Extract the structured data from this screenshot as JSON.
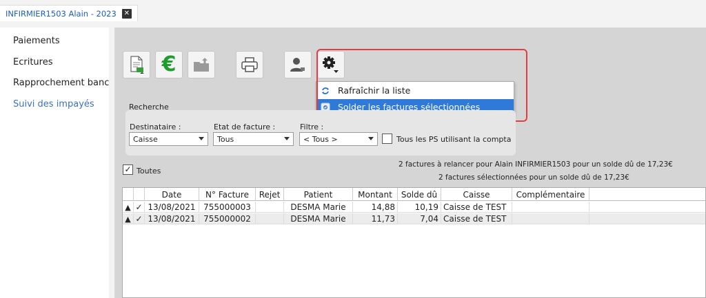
{
  "tab": {
    "title": "INFIRMIER1503 Alain - 2023",
    "close": "✕"
  },
  "sidenav": {
    "items": [
      {
        "label": "Paiements"
      },
      {
        "label": "Ecritures"
      },
      {
        "label": "Rapprochement bancaire"
      },
      {
        "label": "Suivi des impayés"
      }
    ]
  },
  "toolbar": {
    "buttons": [
      "document-mail-icon",
      "euro-icon",
      "folder-export-icon",
      "print-icon",
      "user-icon",
      "settings-gear-icon"
    ]
  },
  "menu": {
    "items": [
      {
        "label": "Rafraîchir la liste",
        "icon": "refresh-icon"
      },
      {
        "label": "Solder les factures sélectionnées",
        "icon": "settle-icon",
        "selected": true
      }
    ]
  },
  "search": {
    "title": "Recherche",
    "destinataire": {
      "label": "Destinataire :",
      "value": "Caisse"
    },
    "etat": {
      "label": "Etat de facture :",
      "value": "Tous"
    },
    "filtre": {
      "label": "Filtre :",
      "value": "< Tous >"
    },
    "tous_ps": {
      "label": "Tous les PS utilisant la compta",
      "checked": false
    }
  },
  "toutes": {
    "label": "Toutes",
    "checked": true,
    "mark": "✓"
  },
  "info": {
    "line1": "2 factures à relancer pour Alain INFIRMIER1503 pour un solde dû de 17,23€",
    "line2": "2 factures sélectionnées pour un solde dû de 17,23€"
  },
  "table": {
    "columns": [
      "",
      "",
      "Date",
      "N° Facture",
      "Rejet",
      "Patient",
      "Montant",
      "Solde dû",
      "Caisse",
      "Complémentaire"
    ],
    "rows": [
      {
        "warn": "▲",
        "check": "✓",
        "date": "13/08/2021",
        "facture": "755000003",
        "rejet": "",
        "patient": "DESMA Marie",
        "montant": "14,88",
        "solde": "10,19",
        "caisse": "Caisse de TEST",
        "comp": ""
      },
      {
        "warn": "▲",
        "check": "✓",
        "date": "13/08/2021",
        "facture": "755000002",
        "rejet": "",
        "patient": "DESMA Marie",
        "montant": "11,73",
        "solde": "7,04",
        "caisse": "Caisse de TEST",
        "comp": ""
      }
    ]
  }
}
